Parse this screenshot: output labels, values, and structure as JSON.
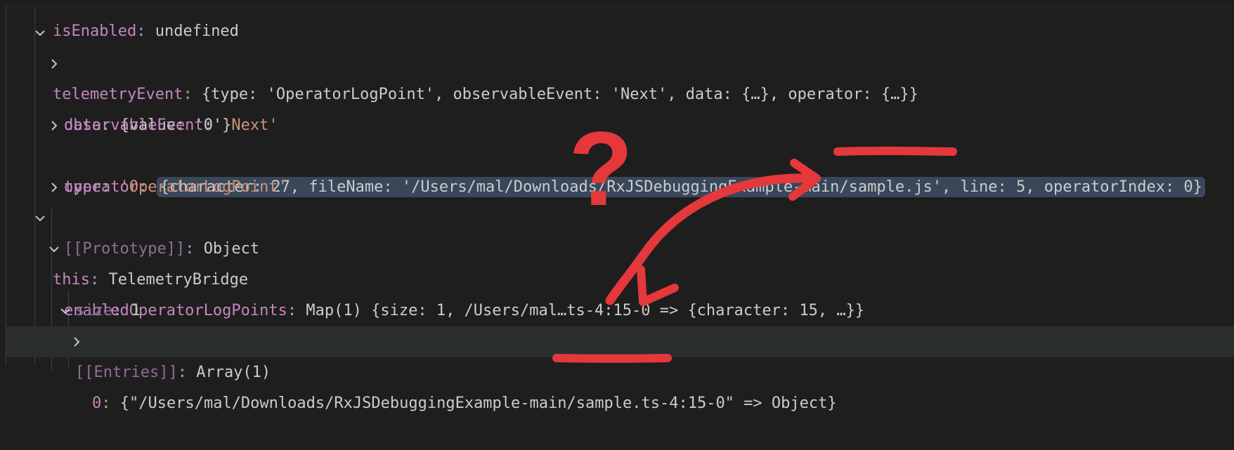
{
  "rows": [
    {
      "name": "isEnabled",
      "value": "undefined"
    },
    {
      "name": "telemetryEvent",
      "value": "{type: 'OperatorLogPoint', observableEvent: 'Next', data: {…}, operator: {…}}"
    },
    {
      "name": "data",
      "value": "{value: '0'}"
    },
    {
      "name": "observableEvent",
      "value": "'Next'"
    },
    {
      "name": "operator",
      "value": "{character: 27, fileName: '/Users/mal/Downloads/RxJSDebuggingExample-main/sample.js', line: 5, operatorIndex: 0}"
    },
    {
      "name": "type",
      "value": "'OperatorLogPoint'"
    },
    {
      "name": "[[Prototype]]",
      "value": "Object"
    },
    {
      "name": "this",
      "value": "TelemetryBridge"
    },
    {
      "name": "enabledOperatorLogPoints",
      "value": "Map(1) {size: 1, /Users/mal…ts-4:15-0 => {character: 15, …}}"
    },
    {
      "name": "size",
      "value": "1"
    },
    {
      "name": "[[Entries]]",
      "value": "Array(1)"
    },
    {
      "name": "0",
      "value": "{\"/Users/mal/Downloads/RxJSDebuggingExample-main/sample.ts-4:15-0\" => Object}"
    }
  ],
  "annotations": {
    "question_mark": "?",
    "color": "#e5383b"
  },
  "colors": {
    "background": "#1e1e1e",
    "property_name": "#c586c0",
    "string_value": "#ce9178",
    "number_value": "#b5cea8",
    "selection": "#38475a"
  }
}
